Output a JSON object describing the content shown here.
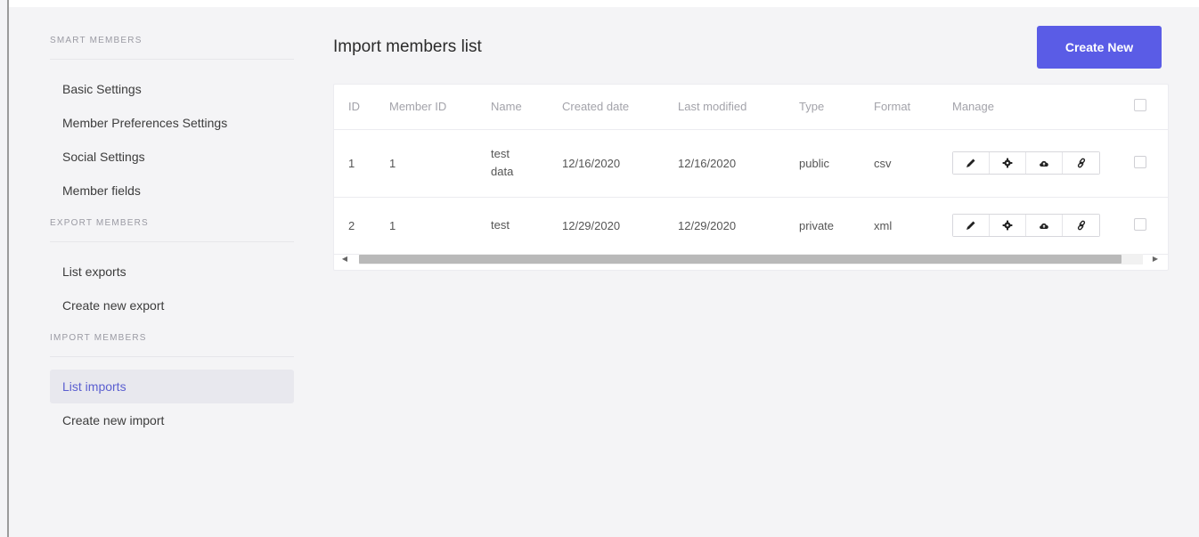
{
  "sidebar": {
    "sections": [
      {
        "title": "SMART MEMBERS",
        "items": [
          "Basic Settings",
          "Member Preferences Settings",
          "Social Settings",
          "Member fields"
        ]
      },
      {
        "title": "EXPORT MEMBERS",
        "items": [
          "List exports",
          "Create new export"
        ]
      },
      {
        "title": "IMPORT MEMBERS",
        "items": [
          "List imports",
          "Create new import"
        ]
      }
    ],
    "active_item": "List imports"
  },
  "main": {
    "title": "Import members list",
    "create_button": "Create New",
    "table": {
      "headers": [
        "ID",
        "Member ID",
        "Name",
        "Created date",
        "Last modified",
        "Type",
        "Format",
        "Manage"
      ],
      "rows": [
        {
          "id": "1",
          "member_id": "1",
          "name_line1": "test",
          "name_line2": "data",
          "created": "12/16/2020",
          "modified": "12/16/2020",
          "type": "public",
          "format": "csv"
        },
        {
          "id": "2",
          "member_id": "1",
          "name_line1": "test",
          "name_line2": "",
          "created": "12/29/2020",
          "modified": "12/29/2020",
          "type": "private",
          "format": "xml"
        }
      ],
      "manage_icons": [
        "pencil-icon",
        "gear-icon",
        "cloud-upload-icon",
        "link-icon"
      ]
    }
  },
  "colors": {
    "accent": "#5a5ce6",
    "active_text": "#5b5fd0",
    "active_bg": "#e8e8ee"
  }
}
